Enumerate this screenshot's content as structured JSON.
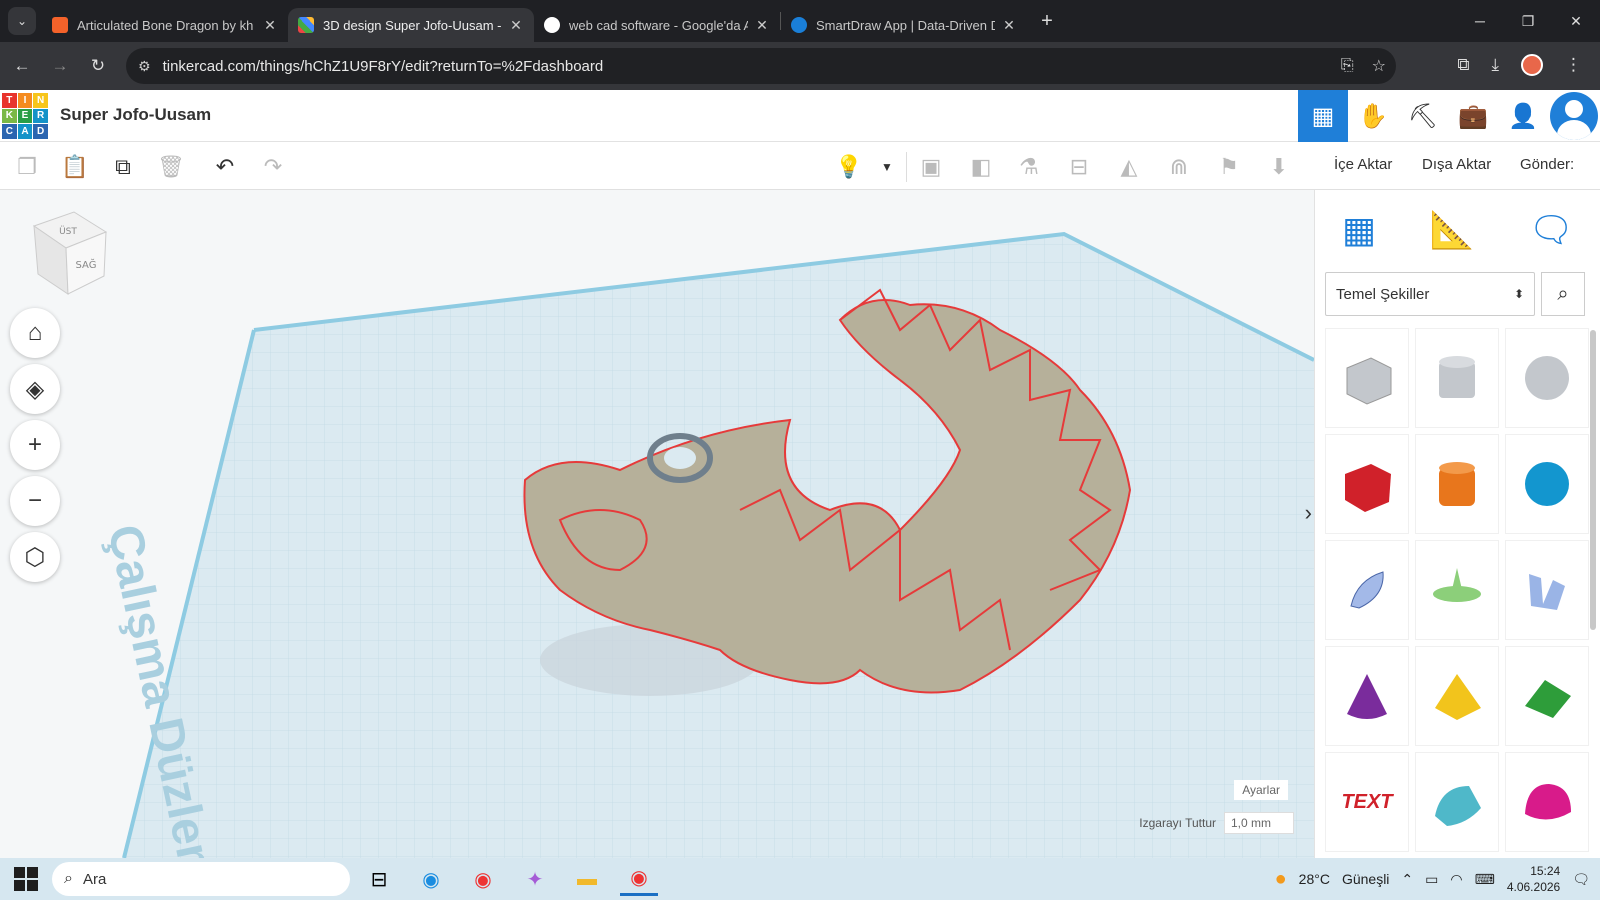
{
  "browser": {
    "tabs": [
      {
        "title": "Articulated Bone Dragon by kh",
        "fav_color": "#f4622a",
        "active": false
      },
      {
        "title": "3D design Super Jofo-Uusam -",
        "fav_color": "#34a853",
        "active": true
      },
      {
        "title": "web cad software - Google'da A",
        "fav_color": "#ffffff",
        "active": false
      },
      {
        "title": "SmartDraw App | Data-Driven D",
        "fav_color": "#1a7fd8",
        "active": false
      }
    ],
    "url": "tinkercad.com/things/hChZ1U9F8rY/edit?returnTo=%2Fdashboard"
  },
  "header": {
    "logo_letters": [
      "T",
      "I",
      "N",
      "K",
      "E",
      "R",
      "C",
      "A",
      "D"
    ],
    "design_title": "Super Jofo-Uusam"
  },
  "toolbar": {
    "import_label": "İçe Aktar",
    "export_label": "Dışa Aktar",
    "send_label": "Gönder:"
  },
  "workspace": {
    "workplane_text": "Çalışma Düzlemi",
    "viewcube_top": "ÜST",
    "viewcube_side": "SAĞ",
    "settings_label": "Ayarlar",
    "snap_label": "Izgarayı Tuttur",
    "snap_value": "1,0 mm"
  },
  "panel": {
    "library": "Temel Şekiller",
    "shapes": [
      {
        "name": "box-hole",
        "color": "#b8bcc2"
      },
      {
        "name": "cylinder-hole",
        "color": "#b8bcc2"
      },
      {
        "name": "sphere-hole",
        "color": "#b8bcc2"
      },
      {
        "name": "box",
        "color": "#d0212a"
      },
      {
        "name": "cylinder",
        "color": "#e8761c"
      },
      {
        "name": "sphere",
        "color": "#1396cf"
      },
      {
        "name": "scribble",
        "color": "#6a8fd6"
      },
      {
        "name": "graphic",
        "color": "#8ccf7a"
      },
      {
        "name": "text-shape",
        "color": "#6a8fd6"
      },
      {
        "name": "cone",
        "color": "#7a2c9c"
      },
      {
        "name": "pyramid",
        "color": "#f2c41c"
      },
      {
        "name": "roof",
        "color": "#2e9d3a"
      },
      {
        "name": "text",
        "color": "#d0212a",
        "text": "TEXT"
      },
      {
        "name": "half-cylinder",
        "color": "#4fb8c9"
      },
      {
        "name": "paraboloid",
        "color": "#d81b8a"
      }
    ]
  },
  "taskbar": {
    "search_placeholder": "Ara",
    "weather": "28°C",
    "weather_text": "Güneşli",
    "time": "15:24",
    "date": "4.06.2026"
  }
}
